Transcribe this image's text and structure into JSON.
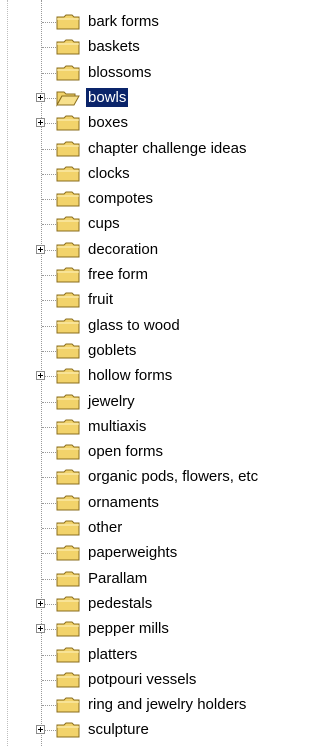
{
  "tree": {
    "items": [
      {
        "label": "bark forms",
        "expandable": false,
        "selected": false
      },
      {
        "label": "baskets",
        "expandable": false,
        "selected": false
      },
      {
        "label": "blossoms",
        "expandable": false,
        "selected": false
      },
      {
        "label": "bowls",
        "expandable": true,
        "selected": true,
        "open": true
      },
      {
        "label": "boxes",
        "expandable": true,
        "selected": false
      },
      {
        "label": "chapter challenge ideas",
        "expandable": false,
        "selected": false
      },
      {
        "label": "clocks",
        "expandable": false,
        "selected": false
      },
      {
        "label": "compotes",
        "expandable": false,
        "selected": false
      },
      {
        "label": "cups",
        "expandable": false,
        "selected": false
      },
      {
        "label": "decoration",
        "expandable": true,
        "selected": false
      },
      {
        "label": "free form",
        "expandable": false,
        "selected": false
      },
      {
        "label": "fruit",
        "expandable": false,
        "selected": false
      },
      {
        "label": "glass to wood",
        "expandable": false,
        "selected": false
      },
      {
        "label": "goblets",
        "expandable": false,
        "selected": false
      },
      {
        "label": "hollow forms",
        "expandable": true,
        "selected": false
      },
      {
        "label": "jewelry",
        "expandable": false,
        "selected": false
      },
      {
        "label": "multiaxis",
        "expandable": false,
        "selected": false
      },
      {
        "label": "open forms",
        "expandable": false,
        "selected": false
      },
      {
        "label": "organic pods, flowers, etc",
        "expandable": false,
        "selected": false
      },
      {
        "label": "ornaments",
        "expandable": false,
        "selected": false
      },
      {
        "label": "other",
        "expandable": false,
        "selected": false
      },
      {
        "label": "paperweights",
        "expandable": false,
        "selected": false
      },
      {
        "label": "Parallam",
        "expandable": false,
        "selected": false
      },
      {
        "label": "pedestals",
        "expandable": true,
        "selected": false
      },
      {
        "label": "pepper mills",
        "expandable": true,
        "selected": false
      },
      {
        "label": "platters",
        "expandable": false,
        "selected": false
      },
      {
        "label": "potpouri vessels",
        "expandable": false,
        "selected": false
      },
      {
        "label": "ring and jewelry holders",
        "expandable": false,
        "selected": false
      },
      {
        "label": "sculpture",
        "expandable": true,
        "selected": false
      }
    ]
  },
  "colors": {
    "selection": "#0a246a",
    "folder": "#f2d36b",
    "folder_outline": "#8a6d1c"
  },
  "icons": {
    "folder": "folder-icon",
    "open_folder": "folder-open-icon",
    "expander": "plus-expander-icon"
  }
}
